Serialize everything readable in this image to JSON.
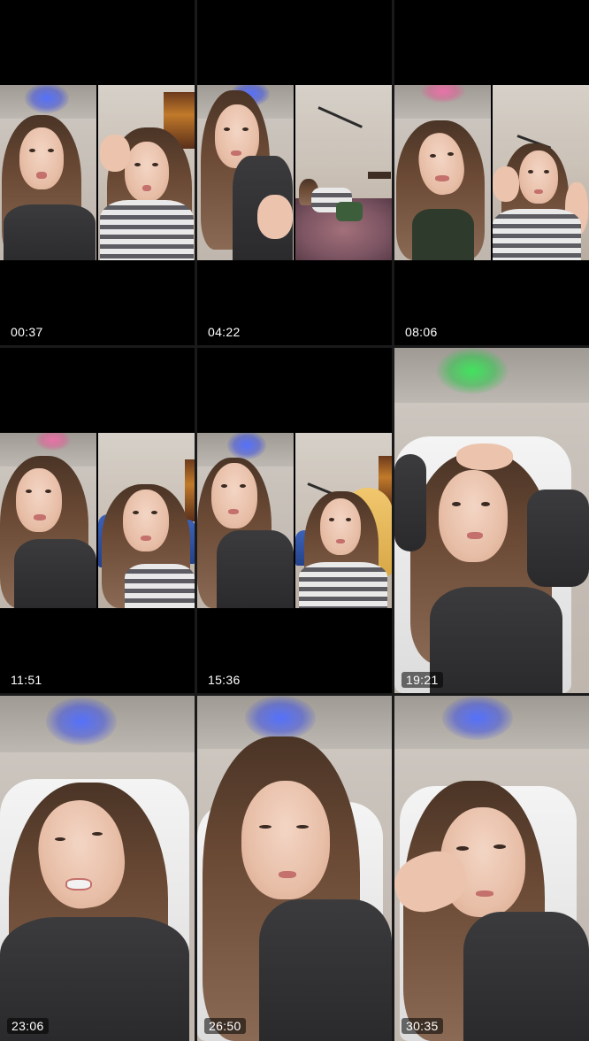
{
  "grid": {
    "columns": 3,
    "rows": 3,
    "cells": [
      {
        "timestamp": "00:37",
        "layout": "split-letterbox"
      },
      {
        "timestamp": "04:22",
        "layout": "split-letterbox"
      },
      {
        "timestamp": "08:06",
        "layout": "split-letterbox"
      },
      {
        "timestamp": "11:51",
        "layout": "split-letterbox"
      },
      {
        "timestamp": "15:36",
        "layout": "split-letterbox"
      },
      {
        "timestamp": "19:21",
        "layout": "fullscreen"
      },
      {
        "timestamp": "23:06",
        "layout": "fullscreen"
      },
      {
        "timestamp": "26:50",
        "layout": "fullscreen"
      },
      {
        "timestamp": "30:35",
        "layout": "fullscreen"
      }
    ]
  },
  "colors": {
    "background": "#000000",
    "divider": "#1a1a1a",
    "timestamp_text": "#ffffff"
  }
}
